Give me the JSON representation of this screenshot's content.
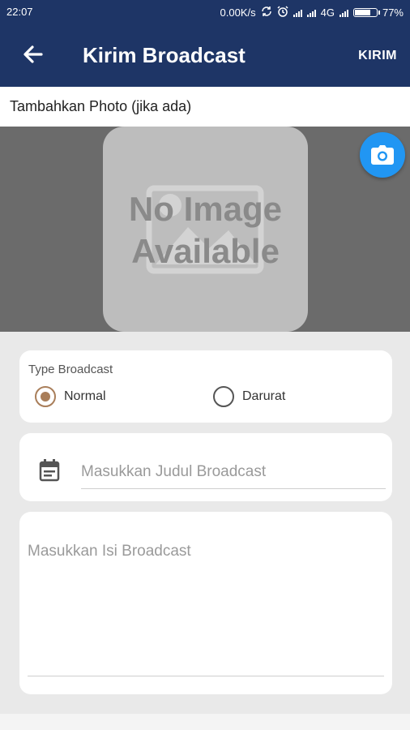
{
  "status_bar": {
    "time": "22:07",
    "net_speed": "0.00K/s",
    "network": "4G",
    "battery": "77%",
    "battery_level": 0.77,
    "icons": [
      "sync-icon",
      "alarm-icon",
      "signal-icon",
      "signal-icon",
      "battery-icon"
    ]
  },
  "app_bar": {
    "title": "Kirim Broadcast",
    "action_label": "KIRIM",
    "back_icon": "arrow-left-icon",
    "color": "#1e3566"
  },
  "photo": {
    "label": "Tambahkan Photo (jika ada)",
    "placeholder_line1": "No Image",
    "placeholder_line2": "Available",
    "camera_icon": "camera-icon",
    "fab_color": "#2196f3"
  },
  "type_broadcast": {
    "label": "Type Broadcast",
    "options": [
      {
        "label": "Normal",
        "checked": true
      },
      {
        "label": "Darurat",
        "checked": false
      }
    ],
    "accent_color": "#a97e5a"
  },
  "judul": {
    "icon": "calendar-icon",
    "value": "",
    "placeholder": "Masukkan Judul Broadcast"
  },
  "isi": {
    "value": "",
    "placeholder": "Masukkan Isi Broadcast"
  }
}
